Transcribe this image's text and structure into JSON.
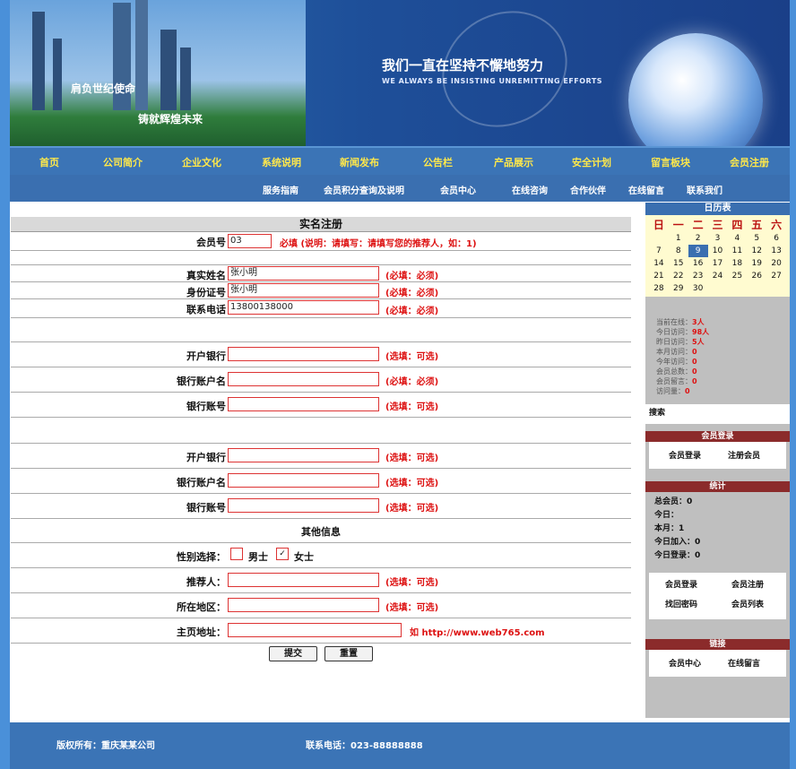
{
  "banner": {
    "city_text_1": "肩负世纪使命",
    "city_text_2": "铸就辉煌未来",
    "slogan": "我们一直在坚持不懈地努力",
    "slogan_sub": "WE ALWAYS BE INSISTING UNREMITTING EFFORTS"
  },
  "nav_main": [
    "首页",
    "公司简介",
    "企业文化",
    "系统说明",
    "新闻发布",
    "公告栏",
    "产品展示",
    "安全计划",
    "留言板块",
    "会员注册"
  ],
  "nav_sub": [
    "服务指南",
    "会员积分查询及说明",
    "会员中心",
    "在线咨询",
    "合作伙伴",
    "在线留言",
    "联系我们"
  ],
  "form": {
    "title": "实名注册",
    "account_label": "会员号",
    "account_value": "03",
    "account_hint": "必填 (说明：请填写：请填写您的推荐人，如：1)",
    "fields_group1": [
      {
        "label": "真实姓名",
        "value": "张小明",
        "hint": "(必填：必须)"
      },
      {
        "label": "身份证号",
        "value": "张小明",
        "hint": "(必填：必须)"
      },
      {
        "label": "联系电话",
        "value": "13800138000",
        "hint": "(必填：必须)"
      }
    ],
    "fields_group2": [
      {
        "label": "开户银行",
        "value": "",
        "hint": "(选填：可选)"
      },
      {
        "label": "银行账户名",
        "value": "",
        "hint": "(必填：必须)"
      },
      {
        "label": "银行账号",
        "value": "",
        "hint": "(选填：可选)"
      }
    ],
    "fields_group3": [
      {
        "label": "开户银行",
        "value": "",
        "hint": "(选填：可选)"
      },
      {
        "label": "银行账户名",
        "value": "",
        "hint": "(选填：可选)"
      },
      {
        "label": "银行账号",
        "value": "",
        "hint": "(选填：可选)"
      }
    ],
    "section_label": "其他信息",
    "gender_label": "性别选择：",
    "gender_male": "男士",
    "gender_female": "女士",
    "fields_group4": [
      {
        "label": "推荐人：",
        "value": "",
        "hint": "(选填：可选)"
      },
      {
        "label": "所在地区：",
        "value": "",
        "hint": "(选填：可选)"
      }
    ],
    "site_label": "主页地址：",
    "site_hint": "如 http://www.web765.com",
    "submit_label": "提交",
    "reset_label": "重置"
  },
  "sidebar": {
    "calendar_title": "日历表",
    "weekdays": [
      "日",
      "一",
      "二",
      "三",
      "四",
      "五",
      "六"
    ],
    "days": [
      "",
      "1",
      "2",
      "3",
      "4",
      "5",
      "6",
      "7",
      "8",
      "9",
      "10",
      "11",
      "12",
      "13",
      "14",
      "15",
      "16",
      "17",
      "18",
      "19",
      "20",
      "21",
      "22",
      "23",
      "24",
      "25",
      "26",
      "27",
      "28",
      "29",
      "30",
      "",
      "",
      "",
      ""
    ],
    "today": "9",
    "stats": [
      {
        "label": "当前在线：",
        "value": "3人"
      },
      {
        "label": "今日访问：",
        "value": "98人"
      },
      {
        "label": "昨日访问：",
        "value": "5人"
      },
      {
        "label": "本月访问：",
        "value": "0"
      },
      {
        "label": "今年访问：",
        "value": "0"
      },
      {
        "label": "会员总数：",
        "value": "0"
      },
      {
        "label": "会员留言：",
        "value": "0"
      },
      {
        "label": "访问量：",
        "value": "0"
      }
    ],
    "search_label": "搜索",
    "box1_title": "会员登录",
    "box1_items": [
      "会员登录",
      "注册会员"
    ],
    "box2_title": "统计",
    "box2_lines": [
      "总会员：0",
      "今日：",
      "本月：1",
      "今日加入：0",
      "今日登录：0"
    ],
    "box2_buttons": [
      "会员登录",
      "会员注册",
      "找回密码",
      "会员列表"
    ],
    "box3_title": "链接",
    "box3_items": [
      "会员中心",
      "在线留言"
    ]
  },
  "footer": {
    "left": "版权所有：重庆某某公司",
    "right": "联系电话：023-88888888"
  }
}
